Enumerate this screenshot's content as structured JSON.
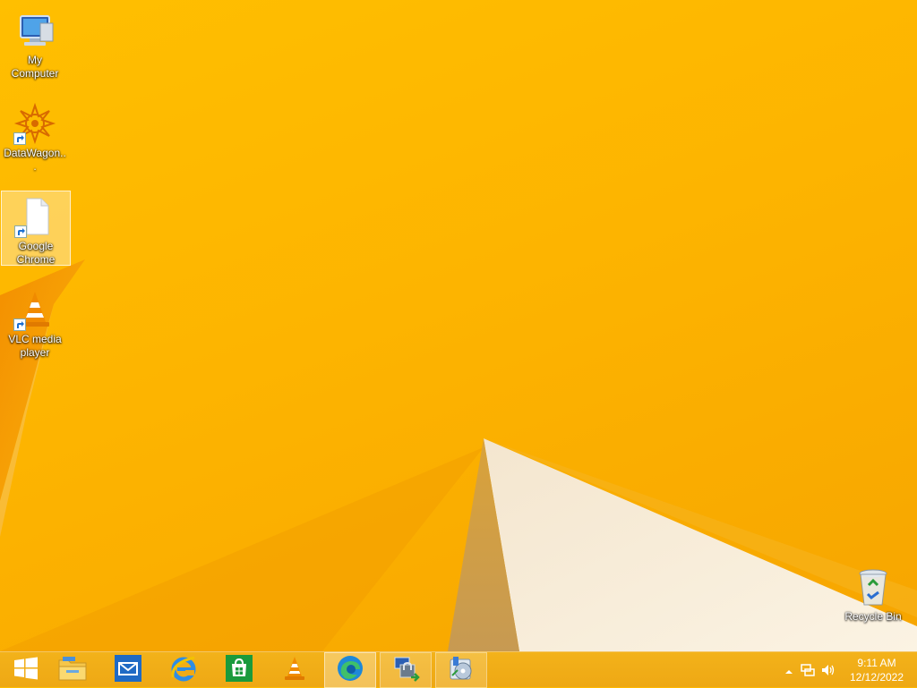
{
  "desktop": {
    "icons": [
      {
        "label": "My Computer"
      },
      {
        "label": "DataWagon..."
      },
      {
        "label": "Google Chrome"
      },
      {
        "label": "VLC media player"
      },
      {
        "label": "Recycle Bin"
      }
    ]
  },
  "taskbar": {
    "buttons": [
      {
        "icon": "windows-start-icon",
        "label": "Start"
      },
      {
        "icon": "file-explorer-icon",
        "label": "File Explorer"
      },
      {
        "icon": "mail-icon",
        "label": "Mail"
      },
      {
        "icon": "internet-explorer-icon",
        "label": "Internet Explorer"
      },
      {
        "icon": "store-icon",
        "label": "Store"
      },
      {
        "icon": "vlc-icon",
        "label": "VLC media player"
      },
      {
        "icon": "edge-icon",
        "label": "Microsoft Edge"
      },
      {
        "icon": "network-share-icon",
        "label": "Network app"
      },
      {
        "icon": "disk-utility-icon",
        "label": "Disk app"
      }
    ],
    "clock": {
      "time": "9:11 AM",
      "date": "12/12/2022"
    }
  },
  "colors": {
    "wallpaper": "#ffbf00",
    "taskbar": "#f0aa16",
    "selection": "#ffffff"
  }
}
